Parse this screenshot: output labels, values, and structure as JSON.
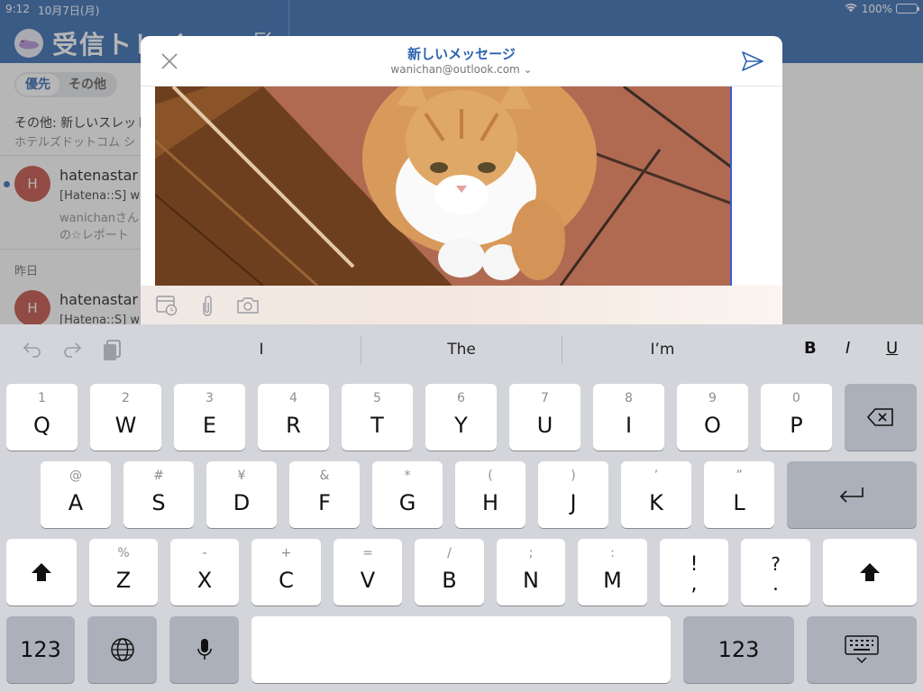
{
  "status_bar": {
    "time": "9:12",
    "date": "10月7日(月)",
    "battery": "100%"
  },
  "inbox": {
    "title": "受信トレイ",
    "filters": [
      "優先",
      "その他"
    ],
    "other_banner": "その他: 新しいスレッド",
    "other_sub": "ホテルズドットコム シ",
    "yesterday_label": "昨日",
    "mails": [
      {
        "avatar": "H",
        "sender": "hatenastar",
        "line1": "[Hatena::S] w",
        "line2": "wanichanさん",
        "line3": "の☆レポート"
      },
      {
        "avatar": "H",
        "sender": "hatenastar",
        "line1": "[Hatena::S] w"
      }
    ]
  },
  "compose": {
    "title": "新しいメッセージ",
    "account": "wanichan@outlook.com ⌄"
  },
  "keyboard": {
    "suggestions": [
      "I",
      "The",
      "I’m"
    ],
    "format": [
      "B",
      "I",
      "U"
    ],
    "row1": [
      [
        "1",
        "Q"
      ],
      [
        "2",
        "W"
      ],
      [
        "3",
        "E"
      ],
      [
        "4",
        "R"
      ],
      [
        "5",
        "T"
      ],
      [
        "6",
        "Y"
      ],
      [
        "7",
        "U"
      ],
      [
        "8",
        "I"
      ],
      [
        "9",
        "O"
      ],
      [
        "0",
        "P"
      ]
    ],
    "row2": [
      [
        "@",
        "A"
      ],
      [
        "#",
        "S"
      ],
      [
        "¥",
        "D"
      ],
      [
        "&",
        "F"
      ],
      [
        "*",
        "G"
      ],
      [
        "(",
        "H"
      ],
      [
        ")",
        "J"
      ],
      [
        "’",
        "K"
      ],
      [
        "”",
        "L"
      ]
    ],
    "row3": [
      [
        "%",
        "Z"
      ],
      [
        "-",
        "X"
      ],
      [
        "+",
        "C"
      ],
      [
        "=",
        "V"
      ],
      [
        "/",
        "B"
      ],
      [
        ";",
        "N"
      ],
      [
        ":",
        "M"
      ],
      [
        "!",
        ","
      ],
      [
        "?",
        "."
      ]
    ],
    "numbers_label": "123"
  },
  "colors": {
    "brand": "#2b63ae",
    "avatar": "#c2473b",
    "key_dark": "#abb0ba"
  }
}
